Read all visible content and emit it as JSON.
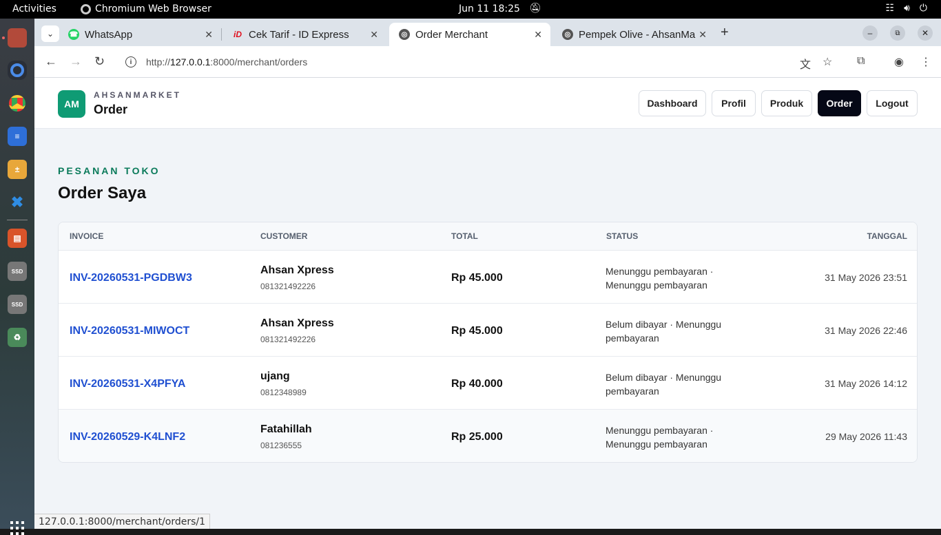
{
  "system": {
    "activities": "Activities",
    "app_name": "Chromium Web Browser",
    "clock": "Jun 11  18:25"
  },
  "tabs": [
    {
      "title": "WhatsApp",
      "icon": "whatsapp-icon",
      "color": "#25d366"
    },
    {
      "title": "Cek Tarif - ID Express",
      "icon": "idexpress-icon",
      "color": "#e0101e"
    },
    {
      "title": "Order Merchant",
      "icon": "globe-icon",
      "color": "#555555"
    },
    {
      "title": "Pempek Olive - AhsanMa",
      "icon": "globe-icon",
      "color": "#555555"
    }
  ],
  "address": {
    "prefix": "http://",
    "host": "127.0.0.1",
    "rest": ":8000/merchant/orders"
  },
  "header": {
    "logo": "AM",
    "brand": "AHSANMARKET",
    "title": "Order",
    "nav": [
      "Dashboard",
      "Profil",
      "Produk",
      "Order",
      "Logout"
    ],
    "active_nav": "Order"
  },
  "main": {
    "eyebrow": "PESANAN TOKO",
    "title": "Order Saya",
    "columns": [
      "INVOICE",
      "CUSTOMER",
      "TOTAL",
      "STATUS",
      "TANGGAL"
    ],
    "orders": [
      {
        "invoice": "INV-20260531-PGDBW3",
        "customer": "Ahsan Xpress",
        "phone": "081321492226",
        "total": "Rp 45.000",
        "status": "Menunggu pembayaran · Menunggu pembayaran",
        "date": "31 May 2026 23:51"
      },
      {
        "invoice": "INV-20260531-MIWOCT",
        "customer": "Ahsan Xpress",
        "phone": "081321492226",
        "total": "Rp 45.000",
        "status": "Belum dibayar · Menunggu pembayaran",
        "date": "31 May 2026 22:46"
      },
      {
        "invoice": "INV-20260531-X4PFYA",
        "customer": "ujang",
        "phone": "0812348989",
        "total": "Rp 40.000",
        "status": "Belum dibayar · Menunggu pembayaran",
        "date": "31 May 2026 14:12"
      },
      {
        "invoice": "INV-20260529-K4LNF2",
        "customer": "Fatahillah",
        "phone": "081236555",
        "total": "Rp 25.000",
        "status": "Menunggu pembayaran · Menunggu pembayaran",
        "date": "29 May 2026 11:43"
      }
    ]
  },
  "statusbar": "127.0.0.1:8000/merchant/orders/1",
  "colors": {
    "brand": "#0f9b74",
    "link": "#1f4fd1",
    "active_nav": "#050816"
  }
}
